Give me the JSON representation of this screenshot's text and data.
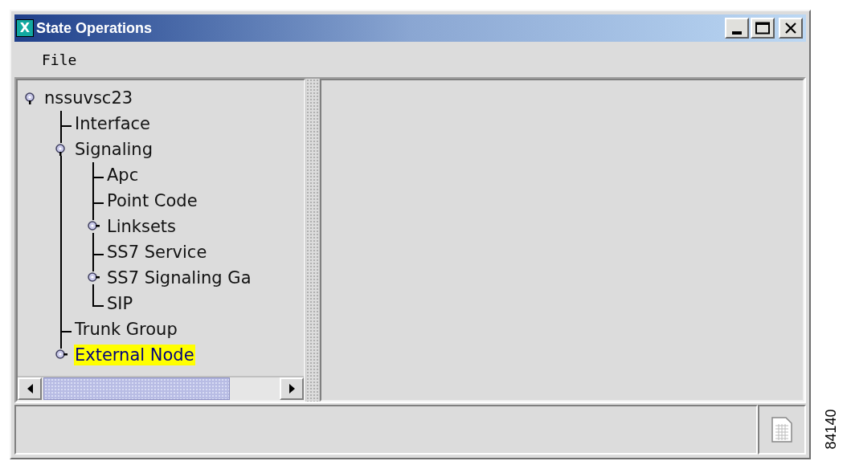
{
  "window": {
    "title": "State Operations",
    "app_icon_letter": "X"
  },
  "menu": [
    {
      "label": "File"
    }
  ],
  "tree": [
    {
      "label": "nssuvsc23",
      "expanded": true,
      "selected": false,
      "children": [
        {
          "label": "Interface",
          "selected": false
        },
        {
          "label": "Signaling",
          "expanded": true,
          "selected": false,
          "children": [
            {
              "label": "Apc",
              "selected": false
            },
            {
              "label": "Point Code",
              "selected": false
            },
            {
              "label": "Linksets",
              "expanded": false,
              "selected": false
            },
            {
              "label": "SS7 Service",
              "selected": false
            },
            {
              "label": "SS7 Signaling Ga",
              "expanded": false,
              "selected": false
            },
            {
              "label": "SIP",
              "selected": false
            }
          ]
        },
        {
          "label": "Trunk Group",
          "selected": false
        },
        {
          "label": "External Node",
          "expanded": false,
          "selected": true
        }
      ]
    }
  ],
  "figure_number": "84140"
}
